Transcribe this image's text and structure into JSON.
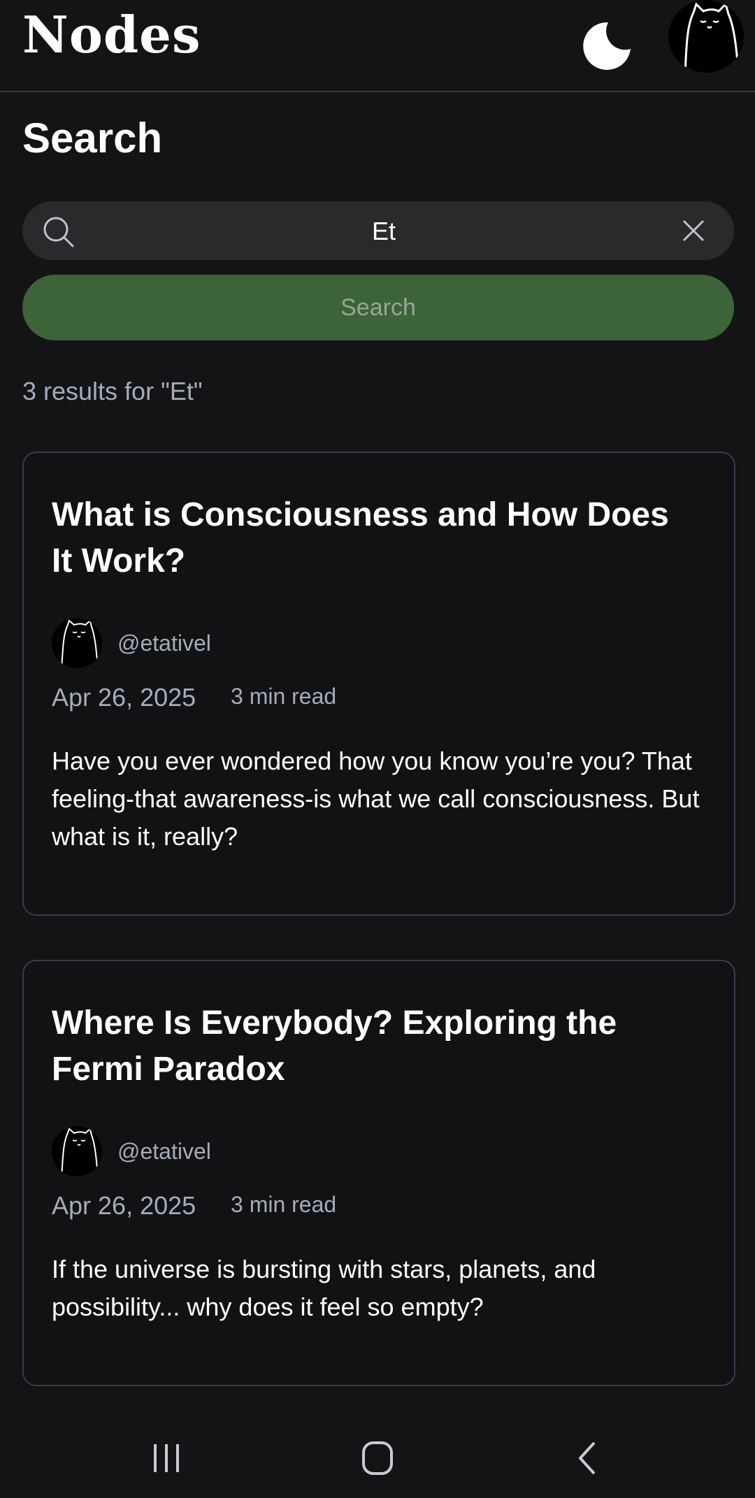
{
  "header": {
    "logo": "Nodes",
    "theme_toggle_icon": "moon-icon",
    "avatar_icon": "cat-avatar-icon"
  },
  "page": {
    "title": "Search"
  },
  "search": {
    "value": "Et",
    "placeholder": "",
    "button_label": "Search"
  },
  "results": {
    "summary": "3 results for \"Et\"",
    "items": [
      {
        "title": "What is Consciousness and How Does It Work?",
        "author": "@etativel",
        "date": "Apr 26, 2025",
        "read_time": "3 min read",
        "excerpt": "Have you ever wondered how you know you’re you? That feeling-that awareness-is what we call consciousness. But what is it, really?"
      },
      {
        "title": "Where Is Everybody? Exploring the Fermi Paradox",
        "author": "@etativel",
        "date": "Apr 26, 2025",
        "read_time": "3 min read",
        "excerpt": "If the universe is bursting with stars, planets, and possibility... why does it feel so empty?"
      }
    ]
  },
  "colors": {
    "background": "#141416",
    "accent_button": "#3d6338",
    "muted_text": "#a4acbc",
    "card_border": "#3a3d48"
  },
  "system_nav": {
    "recents_icon": "recents-icon",
    "home_icon": "home-icon",
    "back_icon": "back-icon"
  }
}
